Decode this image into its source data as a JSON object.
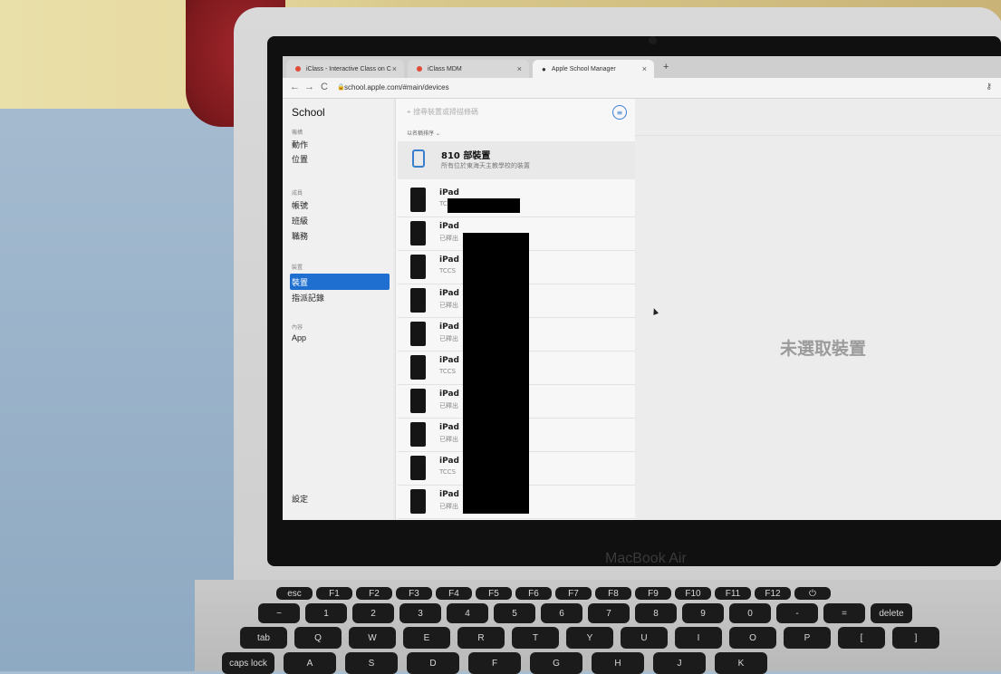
{
  "browser": {
    "tabs": [
      {
        "title": "iClass - Interactive Class on C"
      },
      {
        "title": "iClass MDM"
      },
      {
        "title": "Apple School Manager"
      }
    ],
    "new_tab": "+",
    "nav": {
      "back": "←",
      "forward": "→",
      "reload": "C"
    },
    "url": "school.apple.com/#main/devices"
  },
  "sidebar": {
    "brand": "School",
    "sections": [
      {
        "header": "機構",
        "items": [
          "動作",
          "位置"
        ]
      },
      {
        "header": "成員",
        "items": [
          "帳號",
          "班級",
          "職務"
        ]
      },
      {
        "header": "裝置",
        "items": [
          "裝置",
          "指派記錄"
        ]
      },
      {
        "header": "內容",
        "items": [
          "App"
        ]
      }
    ],
    "active_item": "裝置",
    "footer": "設定"
  },
  "list": {
    "search_placeholder": "搜尋裝置或掃描條碼",
    "sort_label": "以名稱排序 ⌄",
    "summary": {
      "title": "810 部裝置",
      "subtitle": "所有位於東海天主教學校的裝置"
    },
    "devices": [
      {
        "name": "iPad",
        "sub": "TCCS"
      },
      {
        "name": "iPad",
        "sub": "已釋出"
      },
      {
        "name": "iPad",
        "sub": "TCCS"
      },
      {
        "name": "iPad",
        "sub": "已釋出"
      },
      {
        "name": "iPad",
        "sub": "已釋出"
      },
      {
        "name": "iPad",
        "sub": "TCCS"
      },
      {
        "name": "iPad",
        "sub": "已釋出"
      },
      {
        "name": "iPad",
        "sub": "已釋出"
      },
      {
        "name": "iPad",
        "sub": "TCCS"
      },
      {
        "name": "iPad",
        "sub": "已釋出"
      }
    ]
  },
  "detail": {
    "empty_text": "未選取裝置"
  },
  "laptop": {
    "brand": "MacBook Air"
  },
  "keyboard": {
    "row1": [
      "esc",
      "F1",
      "F2",
      "F3",
      "F4",
      "F5",
      "F6",
      "F7",
      "F8",
      "F9",
      "F10",
      "F11",
      "F12",
      "⏻"
    ],
    "row2": [
      "~",
      "1",
      "2",
      "3",
      "4",
      "5",
      "6",
      "7",
      "8",
      "9",
      "0",
      "-",
      "=",
      "delete"
    ],
    "row3": [
      "tab",
      "Q",
      "W",
      "E",
      "R",
      "T",
      "Y",
      "U",
      "I",
      "O",
      "P",
      "[",
      "]"
    ],
    "row4": [
      "caps lock",
      "A",
      "S",
      "D",
      "F",
      "G",
      "H",
      "J",
      "K"
    ]
  },
  "colors": {
    "accent": "#1f6fd0",
    "icon_blue": "#3a7ed0"
  }
}
